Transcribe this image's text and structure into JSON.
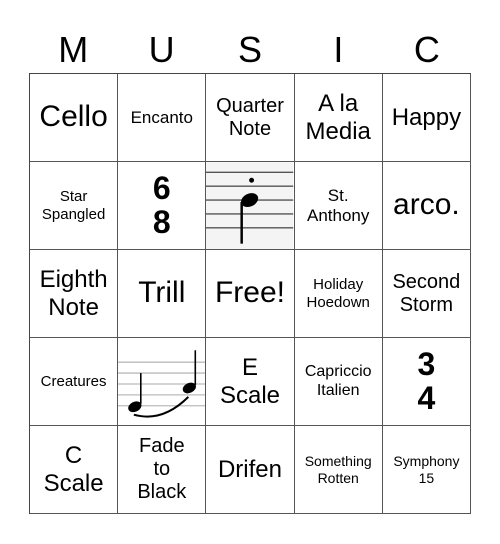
{
  "header": [
    "M",
    "U",
    "S",
    "I",
    "C"
  ],
  "cells": [
    [
      "Cello",
      "Encanto",
      "Quarter Note",
      "A la Media",
      "Happy"
    ],
    [
      "Star Spangled",
      "6/8 time signature",
      "dotted quarter note image",
      "St. Anthony",
      "arco."
    ],
    [
      "Eighth Note",
      "Trill",
      "Free!",
      "Holiday Hoedown",
      "Second Storm"
    ],
    [
      "Creatures",
      "slurred notes image",
      "E Scale",
      "Capriccio Italien",
      "3/4 time signature"
    ],
    [
      "C Scale",
      "Fade to Black",
      "Drifen",
      "Something Rotten",
      "Symphony 15"
    ]
  ],
  "text": {
    "r0c0": "Cello",
    "r0c1": "Encanto",
    "r0c2a": "Quarter",
    "r0c2b": "Note",
    "r0c3a": "A la",
    "r0c3b": "Media",
    "r0c4": "Happy",
    "r1c0a": "Star",
    "r1c0b": "Spangled",
    "r1c1top": "6",
    "r1c1bot": "8",
    "r1c3a": "St.",
    "r1c3b": "Anthony",
    "r1c4": "arco.",
    "r2c0a": "Eighth",
    "r2c0b": "Note",
    "r2c1": "Trill",
    "r2c2": "Free!",
    "r2c3a": "Holiday",
    "r2c3b": "Hoedown",
    "r2c4a": "Second",
    "r2c4b": "Storm",
    "r3c0": "Creatures",
    "r3c2a": "E",
    "r3c2b": "Scale",
    "r3c3a": "Capriccio",
    "r3c3b": "Italien",
    "r3c4top": "3",
    "r3c4bot": "4",
    "r4c0a": "C",
    "r4c0b": "Scale",
    "r4c1a": "Fade",
    "r4c1b": "to",
    "r4c1c": "Black",
    "r4c2": "Drifen",
    "r4c3a": "Something",
    "r4c3b": "Rotten",
    "r4c4a": "Symphony",
    "r4c4b": "15"
  }
}
